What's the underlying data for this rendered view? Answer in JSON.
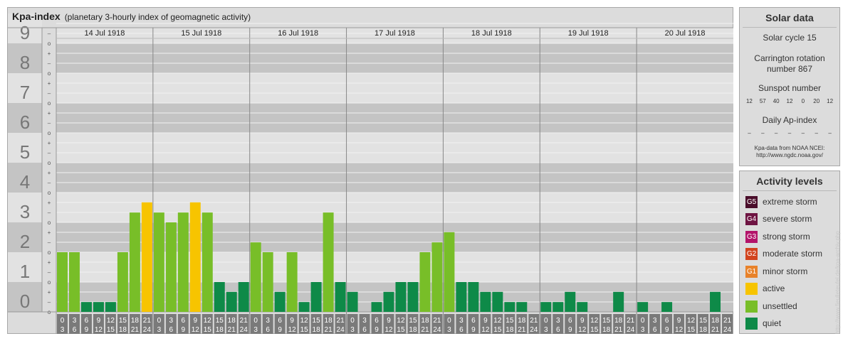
{
  "header": {
    "title": "Kpa-index",
    "subtitle": "(planetary 3-hourly index of geomagnetic activity)"
  },
  "chart_data": {
    "type": "bar",
    "title": "Kpa-index",
    "subtitle": "(planetary 3-hourly index of geomagnetic activity)",
    "ylim": [
      0,
      9
    ],
    "y_ticks": [
      "0",
      "1",
      "2",
      "3",
      "4",
      "5",
      "6",
      "7",
      "8",
      "9"
    ],
    "sub_ticks": [
      "+",
      "o",
      "–"
    ],
    "days": [
      "14 Jul 1918",
      "15 Jul 1918",
      "16 Jul 1918",
      "17 Jul 1918",
      "18 Jul 1918",
      "19 Jul 1918",
      "20 Jul 1918"
    ],
    "interval_labels": [
      [
        "0",
        "3"
      ],
      [
        "3",
        "6"
      ],
      [
        "6",
        "9"
      ],
      [
        "9",
        "12"
      ],
      [
        "12",
        "15"
      ],
      [
        "15",
        "18"
      ],
      [
        "18",
        "21"
      ],
      [
        "21",
        "24"
      ]
    ],
    "values": [
      [
        2,
        2,
        0.33,
        0.33,
        0.33,
        2,
        3.33,
        3.67
      ],
      [
        3.33,
        3,
        3.33,
        3.67,
        3.33,
        1,
        0.67,
        1
      ],
      [
        2.33,
        2,
        0.67,
        2,
        0.33,
        1,
        3.33,
        1
      ],
      [
        0.67,
        0,
        0.33,
        0.67,
        1,
        1,
        2,
        2.33
      ],
      [
        2.67,
        1,
        1,
        0.67,
        0.67,
        0.33,
        0.33,
        0
      ],
      [
        0.33,
        0.33,
        0.67,
        0.33,
        0,
        0,
        0.67,
        0
      ],
      [
        0.33,
        0,
        0.33,
        0,
        0,
        0,
        0.67,
        0
      ]
    ],
    "legend": [
      "active",
      "unsettled",
      "quiet"
    ],
    "colors": {
      "quiet": "#0e8a48",
      "unsettled": "#78be28",
      "active": "#f7c400"
    }
  },
  "solar": {
    "title": "Solar data",
    "cycle": "Solar cycle 15",
    "carrington_1": "Carrington rotation",
    "carrington_2": "number 867",
    "sunspot_title": "Sunspot number",
    "sunspots": [
      "12",
      "57",
      "40",
      "12",
      "0",
      "20",
      "12"
    ],
    "ap_title": "Daily Ap-index",
    "ap": [
      "–",
      "–",
      "–",
      "–",
      "–",
      "–",
      "–"
    ],
    "credit_1": "Kpa-data from NOAA NCEI:",
    "credit_2": "http://www.ngdc.noaa.gov/"
  },
  "levels": {
    "title": "Activity levels",
    "items": [
      {
        "code": "G5",
        "label": "extreme storm",
        "color": "#4a0d2a"
      },
      {
        "code": "G4",
        "label": "severe storm",
        "color": "#6e1442"
      },
      {
        "code": "G3",
        "label": "strong storm",
        "color": "#b3146a"
      },
      {
        "code": "G2",
        "label": "moderate storm",
        "color": "#d2441e"
      },
      {
        "code": "G1",
        "label": "minor storm",
        "color": "#e8822a"
      },
      {
        "code": "",
        "label": "active",
        "color": "#f7c400"
      },
      {
        "code": "",
        "label": "unsettled",
        "color": "#78be28"
      },
      {
        "code": "",
        "label": "quiet",
        "color": "#0e8a48"
      }
    ]
  },
  "watermark": "http://www.fieulleteufel.de/kpa-archiv.php"
}
